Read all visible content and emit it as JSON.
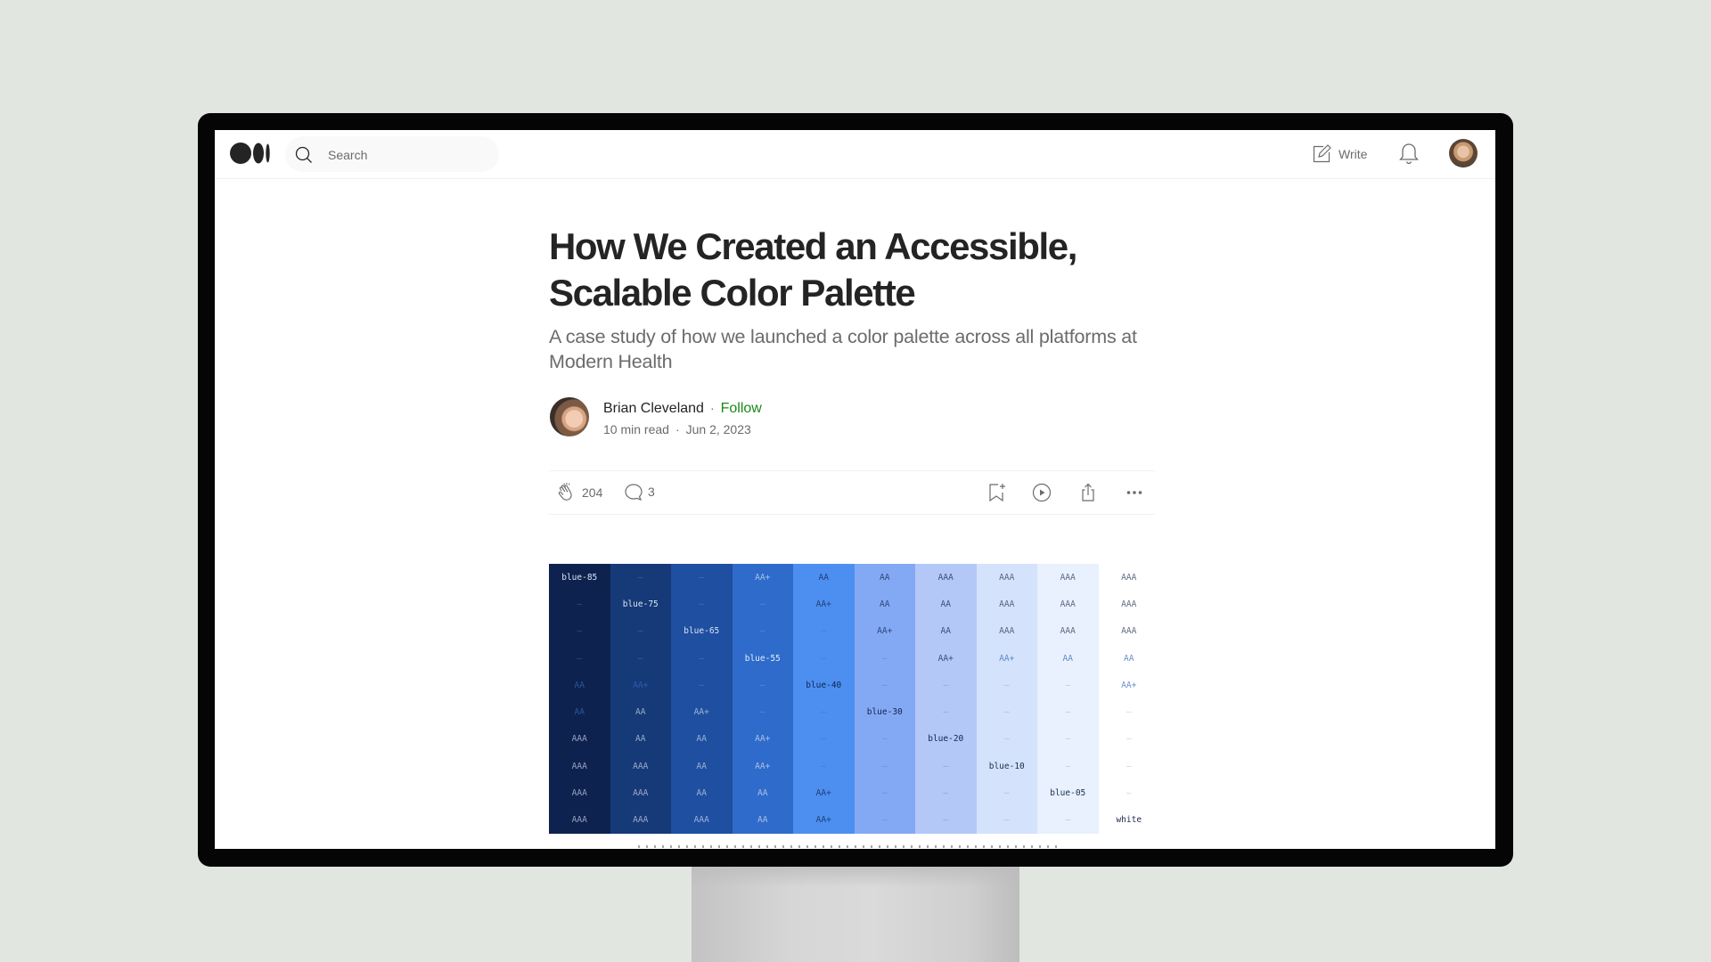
{
  "nav": {
    "logo": "Medium",
    "search_placeholder": "Search",
    "write_label": "Write"
  },
  "article": {
    "title": "How We Created an Accessible, Scalable Color Palette",
    "subtitle": "A case study of how we launched a color palette across all platforms at Modern Health",
    "author": {
      "name": "Brian Cleveland",
      "follow_label": "Follow",
      "read_time": "10 min read",
      "date": "Jun 2, 2023",
      "separator": "·"
    },
    "actions": {
      "claps": "204",
      "responses": "3"
    }
  },
  "colors": {
    "accent_follow": "#1a8917",
    "text_primary": "#242424",
    "text_secondary": "#6b6b6b",
    "backdrop": "#e1e6e1"
  },
  "palette": {
    "columns": [
      {
        "name": "blue-85",
        "bg": "#0e224f",
        "fg": "#dbe4f5",
        "cells": [
          "blue-85",
          "–",
          "–",
          "–",
          "AA",
          "AA",
          "AAA",
          "AAA",
          "AAA",
          "AAA"
        ]
      },
      {
        "name": "blue-75",
        "bg": "#163a78",
        "fg": "#dbe4f5",
        "cells": [
          "–",
          "blue-75",
          "–",
          "–",
          "AA+",
          "AA",
          "AA",
          "AAA",
          "AAA",
          "AAA"
        ]
      },
      {
        "name": "blue-65",
        "bg": "#1f4fa0",
        "fg": "#dbe4f5",
        "cells": [
          "–",
          "–",
          "blue-65",
          "–",
          "–",
          "AA+",
          "AA",
          "AA",
          "AA",
          "AAA"
        ]
      },
      {
        "name": "blue-55",
        "bg": "#2f6bca",
        "fg": "#e4ecfa",
        "cells": [
          "AA+",
          "–",
          "–",
          "blue-55",
          "–",
          "–",
          "AA+",
          "AA+",
          "AA",
          "AA"
        ]
      },
      {
        "name": "blue-40",
        "bg": "#4d8ff0",
        "fg": "#0f2552",
        "cells": [
          "AA",
          "AA+",
          "–",
          "–",
          "blue-40",
          "–",
          "–",
          "–",
          "AA+",
          "AA+"
        ]
      },
      {
        "name": "blue-30",
        "bg": "#84a9f4",
        "fg": "#0f2552",
        "cells": [
          "AA",
          "AA",
          "AA+",
          "–",
          "–",
          "blue-30",
          "–",
          "–",
          "–",
          "–"
        ]
      },
      {
        "name": "blue-20",
        "bg": "#b3c8f7",
        "fg": "#0f2552",
        "cells": [
          "AAA",
          "AA",
          "AA",
          "AA+",
          "–",
          "–",
          "blue-20",
          "–",
          "–",
          "–"
        ]
      },
      {
        "name": "blue-10",
        "bg": "#d4e3fb",
        "fg": "#1b2b4f",
        "cells": [
          "AAA",
          "AAA",
          "AAA",
          "AA+",
          "–",
          "–",
          "–",
          "blue-10",
          "–",
          "–"
        ]
      },
      {
        "name": "blue-05",
        "bg": "#e8f1fd",
        "fg": "#1b2b4f",
        "cells": [
          "AAA",
          "AAA",
          "AAA",
          "AA",
          "–",
          "–",
          "–",
          "–",
          "blue-05",
          "–"
        ]
      },
      {
        "name": "white",
        "bg": "#ffffff",
        "fg": "#1b2b4f",
        "cells": [
          "AAA",
          "AAA",
          "AAA",
          "AA",
          "AA+",
          "–",
          "–",
          "–",
          "–",
          "white"
        ]
      }
    ]
  }
}
